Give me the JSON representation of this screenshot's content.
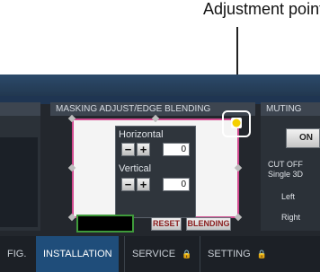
{
  "annotation": {
    "label": "Adjustment point"
  },
  "sections": {
    "masking_title": "MASKING ADJUST/EDGE BLENDING",
    "muting_title": "MUTING"
  },
  "controls": {
    "horizontal_label": "Horizontal",
    "horizontal_value": "0",
    "vertical_label": "Vertical",
    "vertical_value": "0",
    "minus": "−",
    "plus": "+"
  },
  "buttons": {
    "reset": "RESET",
    "blending": "BLENDING",
    "on": "ON"
  },
  "right_panel": {
    "cut_off": "CUT OFF",
    "single": "Single 3D",
    "left": "Left",
    "right": "Right"
  },
  "tabs": [
    {
      "label": "FIG.",
      "locked": false
    },
    {
      "label": "INSTALLATION",
      "locked": false,
      "active": true
    },
    {
      "label": "SERVICE",
      "locked": true
    },
    {
      "label": "SETTING",
      "locked": true
    }
  ],
  "lock_glyph": "🔒",
  "colors": {
    "mask_border": "#d24b90",
    "adjust_point": "#f5d000",
    "green_frame": "#3f9a3b",
    "active_tab": "#1f4d7a"
  }
}
